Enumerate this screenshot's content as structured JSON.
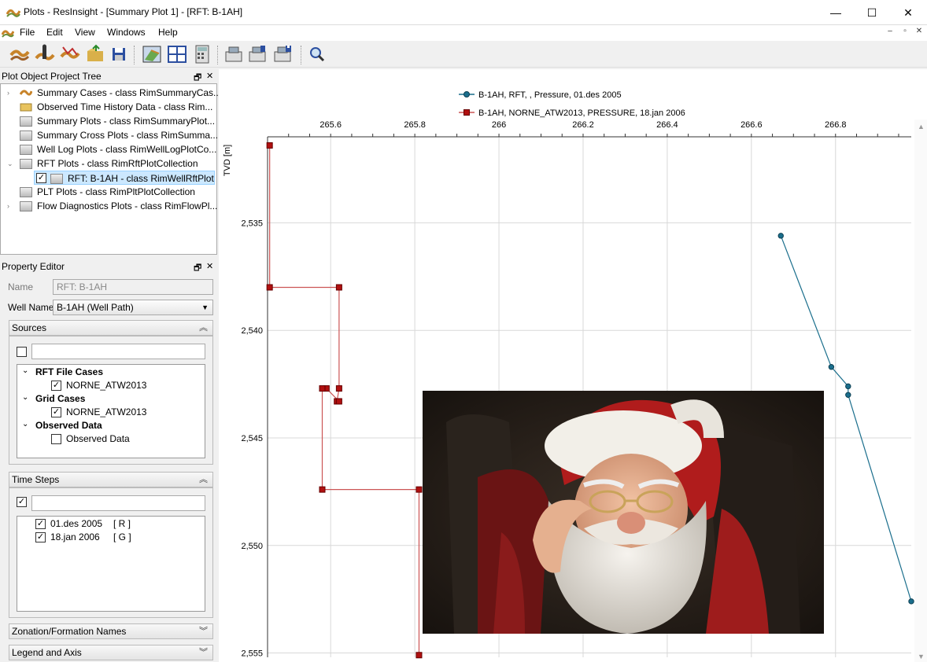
{
  "window": {
    "title": "Plots - ResInsight - [Summary Plot 1] - [RFT: B-1AH]",
    "minimize": "—",
    "maximize": "☐",
    "close": "✕"
  },
  "menu": [
    "File",
    "Edit",
    "View",
    "Windows",
    "Help"
  ],
  "tree_panel": {
    "title": "Plot Object Project Tree",
    "items": [
      {
        "label": "Summary Cases - class RimSummaryCas...",
        "arrow": "›"
      },
      {
        "label": "Observed Time History Data - class Rim...",
        "arrow": ""
      },
      {
        "label": "Summary Plots - class RimSummaryPlot...",
        "arrow": ""
      },
      {
        "label": "Summary Cross Plots - class RimSumma...",
        "arrow": ""
      },
      {
        "label": "Well Log Plots - class RimWellLogPlotCo...",
        "arrow": ""
      },
      {
        "label": "RFT Plots - class RimRftPlotCollection",
        "arrow": "⌄"
      },
      {
        "label": "RFT: B-1AH - class RimWellRftPlot",
        "arrow": ""
      },
      {
        "label": "PLT Plots - class RimPltPlotCollection",
        "arrow": ""
      },
      {
        "label": "Flow Diagnostics Plots - class RimFlowPl...",
        "arrow": "›"
      }
    ]
  },
  "property_panel": {
    "title": "Property Editor",
    "name_label": "Name",
    "name_value": "RFT: B-1AH",
    "well_label": "Well Name",
    "well_value": "B-1AH  (Well Path)",
    "sources_title": "Sources",
    "sources": [
      {
        "label": "RFT File Cases",
        "header": true
      },
      {
        "label": "NORNE_ATW2013",
        "checked": true
      },
      {
        "label": "Grid Cases",
        "header": true
      },
      {
        "label": "NORNE_ATW2013",
        "checked": true
      },
      {
        "label": "Observed Data",
        "header": true
      },
      {
        "label": "Observed Data",
        "checked": false
      }
    ],
    "timesteps_title": "Time Steps",
    "timesteps": [
      {
        "label": "01.des 2005",
        "tag": "[ R ]"
      },
      {
        "label": "18.jan 2006",
        "tag": "[ G ]"
      }
    ],
    "zonation_title": "Zonation/Formation Names",
    "legend_title": "Legend and Axis"
  },
  "chart_data": {
    "type": "line",
    "xlabel": "",
    "ylabel": "TVD [m]",
    "xlim": [
      265.45,
      266.98
    ],
    "ylim": [
      2531,
      2555.2
    ],
    "x_ticks": [
      "265.6",
      "265.8",
      "266",
      "266.2",
      "266.4",
      "266.6",
      "266.8"
    ],
    "x_tick_values": [
      265.6,
      265.8,
      266.0,
      266.2,
      266.4,
      266.6,
      266.8
    ],
    "y_ticks": [
      "2,535",
      "2,540",
      "2,545",
      "2,550",
      "2,555"
    ],
    "y_tick_values": [
      2535,
      2540,
      2545,
      2550,
      2555
    ],
    "grid": true,
    "legend_position": "top",
    "series": [
      {
        "name": "B-1AH, RFT, , Pressure, 01.des 2005",
        "color": "#1a6e8c",
        "marker": "circle",
        "points": [
          [
            266.67,
            2535.6
          ],
          [
            266.79,
            2541.7
          ],
          [
            266.83,
            2542.6
          ],
          [
            266.83,
            2543.0
          ],
          [
            266.98,
            2552.6
          ]
        ]
      },
      {
        "name": "B-1AH, NORNE_ATW2013, PRESSURE, 18.jan 2006",
        "color": "#cc5555",
        "marker": "square",
        "points": [
          [
            265.455,
            2531.4
          ],
          [
            265.455,
            2538.0
          ],
          [
            265.62,
            2538.0
          ],
          [
            265.62,
            2542.7
          ],
          [
            265.615,
            2543.3
          ],
          [
            265.62,
            2543.3
          ],
          [
            265.59,
            2542.7
          ],
          [
            265.58,
            2542.7
          ],
          [
            265.58,
            2547.4
          ],
          [
            265.81,
            2547.4
          ],
          [
            265.81,
            2555.1
          ]
        ]
      }
    ]
  }
}
